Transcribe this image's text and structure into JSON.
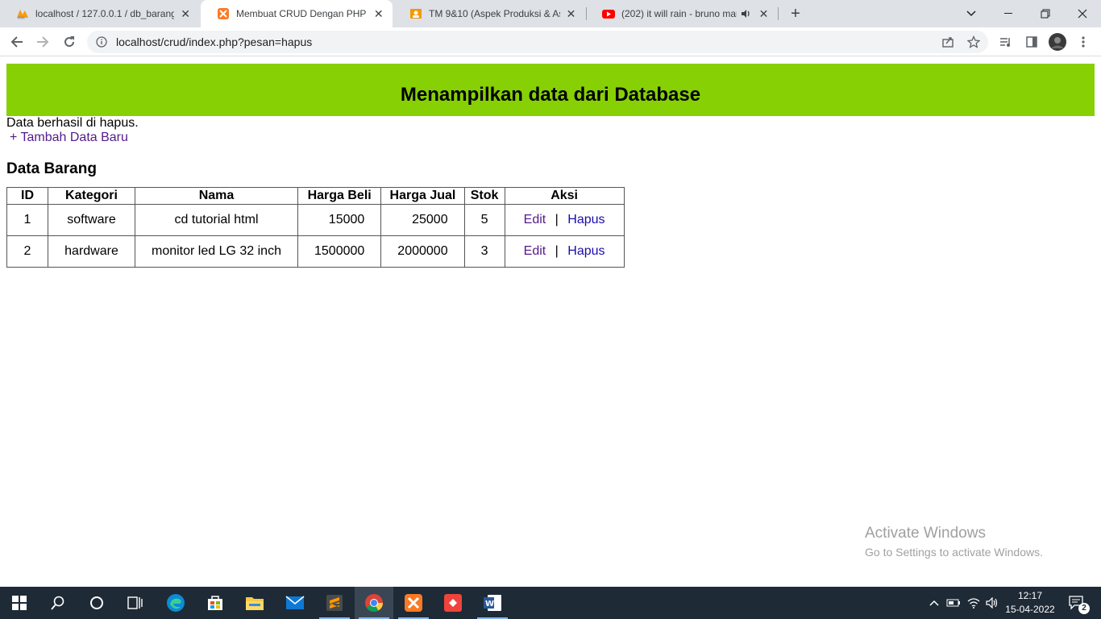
{
  "browser": {
    "tabs": [
      {
        "title": "localhost / 127.0.0.1 / db_barang",
        "icon": "phpmyadmin-icon"
      },
      {
        "title": "Membuat CRUD Dengan PHP Da",
        "icon": "xampp-icon",
        "active": true
      },
      {
        "title": "TM 9&10 (Aspek Produksi & Asp",
        "icon": "classroom-icon"
      },
      {
        "title": "(202) it will rain - bruno mars",
        "icon": "youtube-icon"
      }
    ],
    "url": "localhost/crud/index.php?pesan=hapus"
  },
  "page": {
    "header": "Menampilkan data dari Database",
    "message": "Data berhasil di hapus.",
    "add_link": "+ Tambah Data Baru",
    "section_title": "Data Barang",
    "table": {
      "columns": [
        "ID",
        "Kategori",
        "Nama",
        "Harga Beli",
        "Harga Jual",
        "Stok",
        "Aksi"
      ],
      "rows": [
        [
          "1",
          "software",
          "cd tutorial html",
          "15000",
          "25000",
          "5"
        ],
        [
          "2",
          "hardware",
          "monitor led LG 32 inch",
          "1500000",
          "2000000",
          "3"
        ]
      ],
      "edit_label": "Edit",
      "separator": "|",
      "delete_label": "Hapus"
    }
  },
  "watermark": {
    "line1": "Activate Windows",
    "line2": "Go to Settings to activate Windows."
  },
  "taskbar": {
    "time": "12:17",
    "date": "15-04-2022",
    "notifications": "2"
  },
  "colors": {
    "header_band": "#87d004",
    "visited_link": "#551a8b",
    "link": "#1a0dab",
    "taskbar": "#1e2a36"
  }
}
